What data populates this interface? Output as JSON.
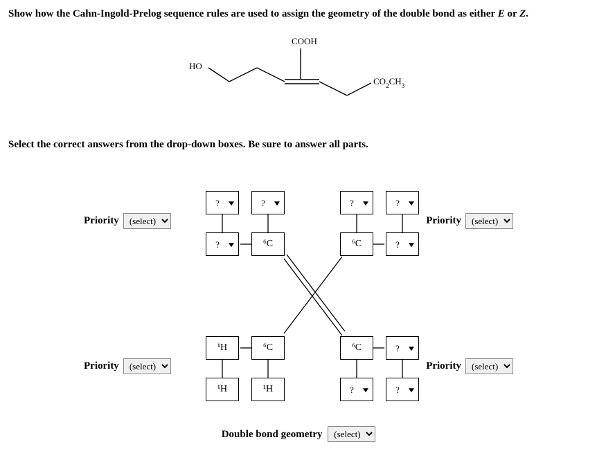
{
  "question": {
    "prefix": "Show how the Cahn-Ingold-Prelog sequence rules are used to assign the geometry of the double bond as either ",
    "e": "E",
    "or": " or ",
    "z": "Z",
    "suffix": "."
  },
  "instruction": "Select the correct answers from the drop-down boxes. Be sure to answer all parts.",
  "molecule_labels": {
    "ho": "HO",
    "cooh": "COOH",
    "co2ch3_a": "CO",
    "co2ch3_b": "2",
    "co2ch3_c": "CH",
    "co2ch3_d": "3"
  },
  "atom_boxes": {
    "placeholder": "?",
    "six_c": "⁶C",
    "one_h": "¹H"
  },
  "priority_label": "Priority",
  "select_placeholder": "(select)",
  "geometry_label": "Double bond geometry"
}
